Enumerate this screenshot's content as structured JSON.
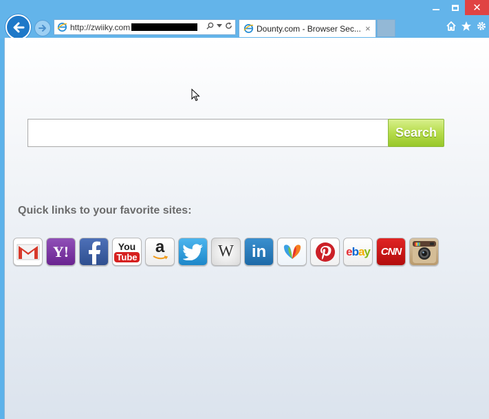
{
  "browser": {
    "address_url": "http://zwiiky.com",
    "tab_title": "Dounty.com - Browser Sec...",
    "tab_close": "×",
    "close_glyph": "✕"
  },
  "search": {
    "button_label": "Search",
    "input_value": ""
  },
  "quick_links": {
    "title": "Quick links to your favorite sites:",
    "items": [
      {
        "name": "gmail",
        "icon": "gmail-icon",
        "color": "#ffffff"
      },
      {
        "name": "yahoo",
        "icon": "yahoo-icon",
        "color": "#7b2fa0"
      },
      {
        "name": "facebook",
        "icon": "facebook-icon",
        "color": "#3b5998"
      },
      {
        "name": "youtube",
        "icon": "youtube-icon",
        "color": "#ffffff"
      },
      {
        "name": "amazon",
        "icon": "amazon-icon",
        "color": "#ffffff"
      },
      {
        "name": "twitter",
        "icon": "twitter-icon",
        "color": "#2d9fe0"
      },
      {
        "name": "wikipedia",
        "icon": "wikipedia-icon",
        "color": "#f4f4f4"
      },
      {
        "name": "linkedin",
        "icon": "linkedin-icon",
        "color": "#2a7bb9"
      },
      {
        "name": "msn",
        "icon": "msn-icon",
        "color": "#ffffff"
      },
      {
        "name": "pinterest",
        "icon": "pinterest-icon",
        "color": "#ffffff"
      },
      {
        "name": "ebay",
        "icon": "ebay-icon",
        "color": "#ffffff"
      },
      {
        "name": "cnn",
        "icon": "cnn-icon",
        "color": "#cc1111"
      },
      {
        "name": "instagram",
        "icon": "instagram-icon",
        "color": "#c9b08a"
      }
    ]
  },
  "icon_text": {
    "yahoo": "Y!",
    "youtube_top": "You",
    "youtube_bottom": "Tube",
    "amazon": "a",
    "wikipedia": "W",
    "linkedin": "in",
    "ebay_e": "e",
    "ebay_b": "b",
    "ebay_a": "a",
    "ebay_y": "y",
    "cnn": "CNN"
  }
}
